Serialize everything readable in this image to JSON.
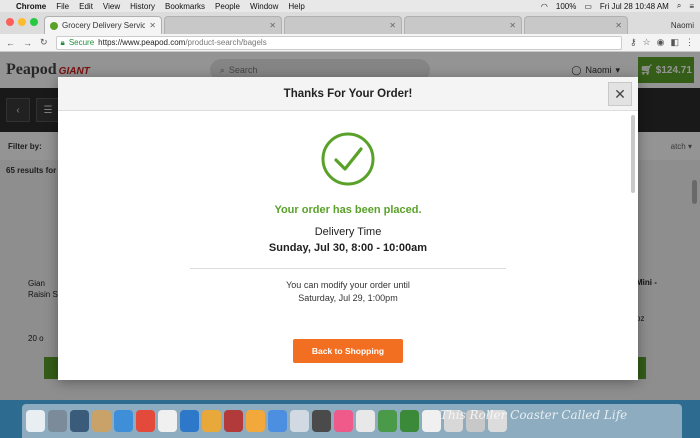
{
  "menubar": {
    "app_name": "Chrome",
    "menus": [
      "File",
      "Edit",
      "View",
      "History",
      "Bookmarks",
      "People",
      "Window",
      "Help"
    ],
    "battery": "100%",
    "clock": "Fri Jul 28  10:48 AM"
  },
  "browser": {
    "tabs": [
      {
        "title": "Grocery Delivery Service | O",
        "active": true
      },
      {
        "title": "",
        "active": false
      },
      {
        "title": "",
        "active": false
      },
      {
        "title": "",
        "active": false
      },
      {
        "title": "",
        "active": false
      }
    ],
    "profile": "Naomi",
    "secure_label": "Secure",
    "url_host": "https://www.peapod.com",
    "url_path": "/product-search/bagels"
  },
  "site": {
    "logo": "Peapod",
    "logo_partner": "GIANT",
    "search_placeholder": "Search",
    "user": "Naomi",
    "cart_total": "$124.71",
    "filter_label": "Filter by:",
    "sort_label": "atch",
    "results_text": "65 results for",
    "product_left": "Gian Raisin S",
    "product_left_size": "20 o",
    "product_right": "Mini -",
    "product_right_size": "oz"
  },
  "modal": {
    "title": "Thanks For Your Order!",
    "close_icon": "close-icon",
    "status": "Your order has been placed.",
    "delivery_label": "Delivery Time",
    "delivery_value": "Sunday, Jul 30, 8:00 - 10:00am",
    "modify_line1": "You can modify your order until",
    "modify_line2": "Saturday, Jul 29, 1:00pm",
    "cta": "Back to Shopping",
    "accent_green": "#5aa12a",
    "cta_color": "#f26f21"
  },
  "dock": {
    "icon_colors": [
      "#e9eef3",
      "#7c8b9a",
      "#3b5b7a",
      "#c9a26a",
      "#3f8fd8",
      "#e44a3c",
      "#f0f0f0",
      "#2d78c8",
      "#e9a83a",
      "#b23a3a",
      "#f2a83b",
      "#4c8fe0",
      "#d1d9e2",
      "#4a4a4a",
      "#f05a8a",
      "#e8e8e8",
      "#4a9a4a",
      "#3a8a3a",
      "#f0f0f0",
      "#d8d8d8",
      "#c8c8c8",
      "#dcdcdc"
    ],
    "watermark": "This Roller Coaster Called Life"
  }
}
